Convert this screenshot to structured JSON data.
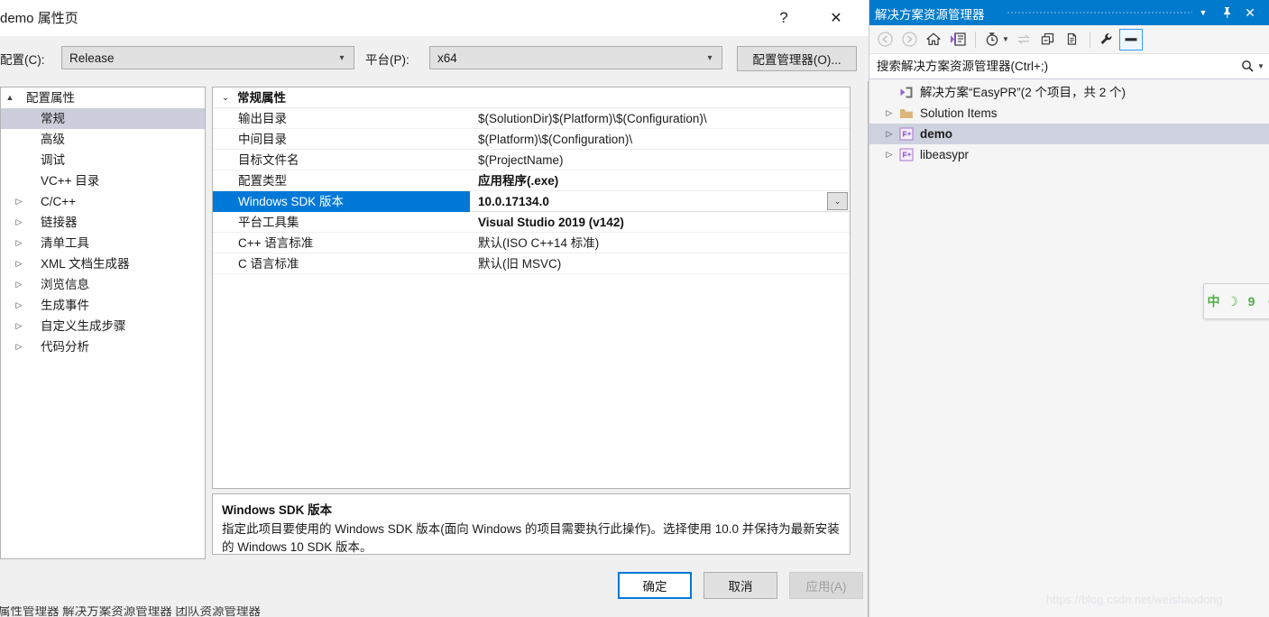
{
  "dialog": {
    "title": "demo 属性页",
    "help_label": "?",
    "close_label": "✕",
    "config_label": "配置(C):",
    "config_value": "Release",
    "platform_label": "平台(P):",
    "platform_value": "x64",
    "config_manager_button": "配置管理器(O)...",
    "tree": [
      {
        "label": "配置属性",
        "expander": "▲",
        "level": 0,
        "selected": false
      },
      {
        "label": "常规",
        "expander": "",
        "level": 1,
        "selected": true
      },
      {
        "label": "高级",
        "expander": "",
        "level": 1,
        "selected": false
      },
      {
        "label": "调试",
        "expander": "",
        "level": 1,
        "selected": false
      },
      {
        "label": "VC++ 目录",
        "expander": "",
        "level": 1,
        "selected": false
      },
      {
        "label": "C/C++",
        "expander": "▷",
        "level": 1,
        "selected": false
      },
      {
        "label": "链接器",
        "expander": "▷",
        "level": 1,
        "selected": false
      },
      {
        "label": "清单工具",
        "expander": "▷",
        "level": 1,
        "selected": false
      },
      {
        "label": "XML 文档生成器",
        "expander": "▷",
        "level": 1,
        "selected": false
      },
      {
        "label": "浏览信息",
        "expander": "▷",
        "level": 1,
        "selected": false
      },
      {
        "label": "生成事件",
        "expander": "▷",
        "level": 1,
        "selected": false
      },
      {
        "label": "自定义生成步骤",
        "expander": "▷",
        "level": 1,
        "selected": false
      },
      {
        "label": "代码分析",
        "expander": "▷",
        "level": 1,
        "selected": false
      }
    ],
    "grid": {
      "group_header": "常规属性",
      "group_expander": "⌄",
      "rows": [
        {
          "name": "输出目录",
          "value": "$(SolutionDir)$(Platform)\\$(Configuration)\\",
          "bold": false,
          "selected": false,
          "dropdown": false
        },
        {
          "name": "中间目录",
          "value": "$(Platform)\\$(Configuration)\\",
          "bold": false,
          "selected": false,
          "dropdown": false
        },
        {
          "name": "目标文件名",
          "value": "$(ProjectName)",
          "bold": false,
          "selected": false,
          "dropdown": false
        },
        {
          "name": "配置类型",
          "value": "应用程序(.exe)",
          "bold": true,
          "selected": false,
          "dropdown": false
        },
        {
          "name": "Windows SDK 版本",
          "value": "10.0.17134.0",
          "bold": true,
          "selected": true,
          "dropdown": true
        },
        {
          "name": "平台工具集",
          "value": "Visual Studio 2019 (v142)",
          "bold": true,
          "selected": false,
          "dropdown": false
        },
        {
          "name": "C++ 语言标准",
          "value": "默认(ISO C++14 标准)",
          "bold": false,
          "selected": false,
          "dropdown": false
        },
        {
          "name": "C 语言标准",
          "value": "默认(旧 MSVC)",
          "bold": false,
          "selected": false,
          "dropdown": false
        }
      ]
    },
    "description": {
      "title": "Windows SDK 版本",
      "body": "指定此项目要使用的 Windows SDK 版本(面向 Windows 的项目需要执行此操作)。选择使用 10.0 并保持为最新安装的 Windows 10 SDK 版本。"
    },
    "buttons": {
      "ok": "确定",
      "cancel": "取消",
      "apply": "应用(A)"
    },
    "bottom_clipped_text": "属性管理器   解决方案资源管理器   团队资源管理器"
  },
  "solution_explorer": {
    "title": "解决方案资源管理器",
    "menu_icon": "▼",
    "pin_icon": "pin",
    "close_icon": "✕",
    "toolbar": [
      {
        "name": "back-icon",
        "enabled": false
      },
      {
        "name": "forward-icon",
        "enabled": true
      },
      {
        "name": "home-icon",
        "enabled": true
      },
      {
        "name": "solution-view-icon",
        "enabled": true
      },
      {
        "name": "pending-changes-icon",
        "enabled": true
      },
      {
        "name": "sync-with-active-document-icon",
        "enabled": false
      },
      {
        "name": "collapse-all-icon",
        "enabled": true
      },
      {
        "name": "show-all-files-icon",
        "enabled": true
      },
      {
        "name": "properties-wrench-icon",
        "enabled": true
      },
      {
        "name": "preview-selected-items-icon",
        "enabled": true
      }
    ],
    "search_placeholder": "搜索解决方案资源管理器(Ctrl+;)",
    "search_value": "",
    "tree": [
      {
        "label": "解决方案“EasyPR”(2 个项目，共 2 个)",
        "expander": "",
        "icon": "solution-icon",
        "selected": false,
        "bold": false
      },
      {
        "label": "Solution Items",
        "expander": "▷",
        "icon": "folder-icon",
        "selected": false,
        "bold": false
      },
      {
        "label": "demo",
        "expander": "▷",
        "icon": "cpp-project-icon",
        "selected": true,
        "bold": true
      },
      {
        "label": "libeasypr",
        "expander": "▷",
        "icon": "cpp-project-icon",
        "selected": false,
        "bold": false
      }
    ]
  },
  "ime_bar": {
    "items": [
      "中",
      "☽",
      "9",
      "•"
    ]
  },
  "watermark": "https://blog.csdn.net/weishaodong",
  "colors": {
    "se_title_bg": "#007acc",
    "grid_selection": "#0078d7",
    "tree_selection": "#cccedb",
    "se_tree_selection": "#cdd2de",
    "ime_green": "#4caf3f"
  }
}
